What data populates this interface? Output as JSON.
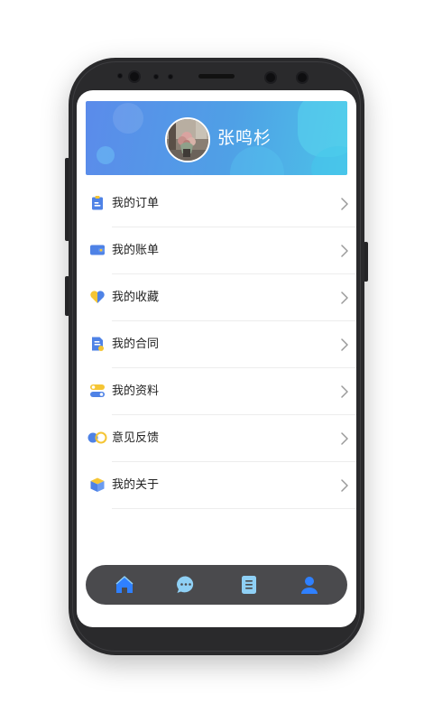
{
  "profile": {
    "username": "张鸣杉",
    "avatar": "avatar-photo"
  },
  "menu": {
    "items": [
      {
        "label": "我的订单",
        "icon": "clipboard-icon"
      },
      {
        "label": "我的账单",
        "icon": "wallet-icon"
      },
      {
        "label": "我的收藏",
        "icon": "heart-icon"
      },
      {
        "label": "我的合同",
        "icon": "document-icon"
      },
      {
        "label": "我的资料",
        "icon": "toggle-card-icon"
      },
      {
        "label": "意见反馈",
        "icon": "feedback-icon"
      },
      {
        "label": "我的关于",
        "icon": "box-icon"
      }
    ]
  },
  "tabbar": {
    "tabs": [
      {
        "name": "home",
        "icon": "home-icon",
        "active": true
      },
      {
        "name": "messages",
        "icon": "chat-bubble-icon",
        "active": false
      },
      {
        "name": "list",
        "icon": "list-icon",
        "active": false
      },
      {
        "name": "profile",
        "icon": "user-icon",
        "active": false
      }
    ]
  },
  "colors": {
    "banner_start": "#5b8bea",
    "banner_end": "#4cc3e8",
    "icon_blue": "#4e82e6",
    "icon_yellow": "#f5c534",
    "tabbar_bg": "#4a4a4d",
    "tab_active": "#2f80ff",
    "tab_inactive": "#8fd0f5"
  }
}
